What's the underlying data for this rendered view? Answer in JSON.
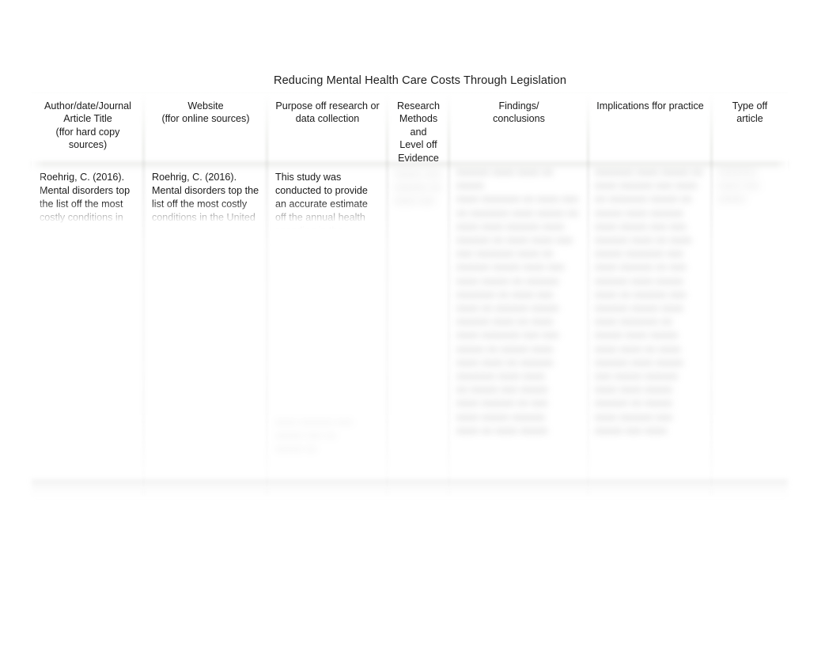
{
  "document": {
    "title": "Reducing Mental Health Care Costs Through Legislation"
  },
  "table": {
    "columns": [
      {
        "key": "author",
        "header": "Author/date/Journal Article Title\n(ffor hard copy sources)",
        "header_lines": [
          "Author/date/Journal",
          "Article Title",
          "(ffor hard copy",
          "sources)"
        ]
      },
      {
        "key": "website",
        "header": "Website\n(ffor online sources)",
        "header_lines": [
          "Website",
          "(ffor online sources)"
        ]
      },
      {
        "key": "purpose",
        "header": "Purpose off research or data collection",
        "header_lines": [
          "Purpose off research or",
          "data collection"
        ]
      },
      {
        "key": "methods",
        "header": "Research Methods and Level off Evidence",
        "header_lines": [
          "Research",
          "Methods",
          "and",
          "Level off",
          "Evidence"
        ]
      },
      {
        "key": "findings",
        "header": "Findings/ conclusions",
        "header_lines": [
          "Findings/",
          "conclusions"
        ]
      },
      {
        "key": "implications",
        "header": "Implications ffor practice",
        "header_lines": [
          "Implications ffor practice"
        ]
      },
      {
        "key": "type",
        "header": "Type off article",
        "header_lines": [
          "Type off",
          "article"
        ]
      }
    ],
    "rows": [
      {
        "author": "Roehrig, C. (2016). Mental disorders top the list off the most costly conditions in",
        "website": "Roehrig, C. (2016). Mental disorders top the list off the most costly conditions in the United",
        "purpose": "This study was conducted to provide an accurate estimate off the annual health spending in the",
        "methods": "",
        "findings": "",
        "implications": "",
        "type": ""
      }
    ],
    "illegible_note": "Text in the Research Methods, Findings/conclusions, Implications ffor practice and Type off article cells is blurred and unreadable."
  },
  "colors": {
    "header_fill": "#e3ecda",
    "page_background": "#ffffff",
    "text": "#1b1b1b",
    "blurred_text": "#9a9a9a"
  }
}
